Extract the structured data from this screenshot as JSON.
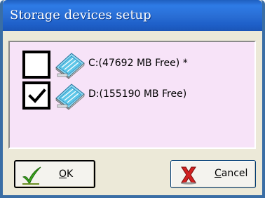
{
  "window": {
    "title": "Storage devices setup",
    "titlebar_color": "#2A6FD6",
    "frame_color": "#3A6EA5",
    "background_color": "#ECE9D8"
  },
  "device_list": {
    "background_color": "#F7E3F8",
    "items": [
      {
        "checked": false,
        "icon": "drive-icon",
        "label": "C:(47692 MB Free) *"
      },
      {
        "checked": true,
        "icon": "drive-icon",
        "label": "D:(155190 MB Free)"
      }
    ]
  },
  "buttons": {
    "ok": {
      "mnemonic": "O",
      "rest": "K",
      "icon": "green-checkmark-icon"
    },
    "cancel": {
      "mnemonic": "C",
      "rest": "ancel",
      "icon": "red-x-icon"
    }
  }
}
